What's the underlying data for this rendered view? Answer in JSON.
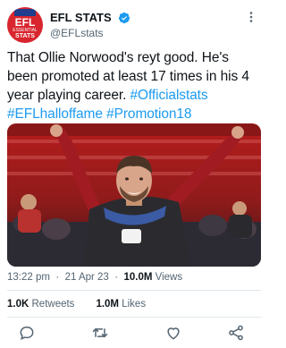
{
  "header": {
    "display_name": "EFL STATS",
    "handle": "@EFLstats",
    "avatar_text": {
      "line1": "EFL",
      "line2": "ESSENTIAL",
      "line3": "STATS"
    }
  },
  "tweet": {
    "text_plain": "That Ollie Norwood's reyt good. He's been promoted at least 17 times in his 4 year playing career. ",
    "hashtags": [
      "#Officialstats",
      "#EFLhalloffame",
      "#Promotion18"
    ]
  },
  "meta": {
    "time": "13:22 pm",
    "date": "21 Apr 23",
    "views_count": "10.0M",
    "views_label": "Views"
  },
  "stats": {
    "retweets_count": "1.0K",
    "retweets_label": "Retweets",
    "likes_count": "1.0M",
    "likes_label": "Likes"
  },
  "icons": {
    "verified": "verified-badge-icon",
    "more": "more-options-icon",
    "reply": "reply-icon",
    "retweet": "retweet-icon",
    "like": "like-icon",
    "share": "share-icon"
  },
  "colors": {
    "accent": "#1d9bf0",
    "avatar_bg": "#d8252e",
    "text": "#0f1419",
    "secondary": "#536471"
  }
}
